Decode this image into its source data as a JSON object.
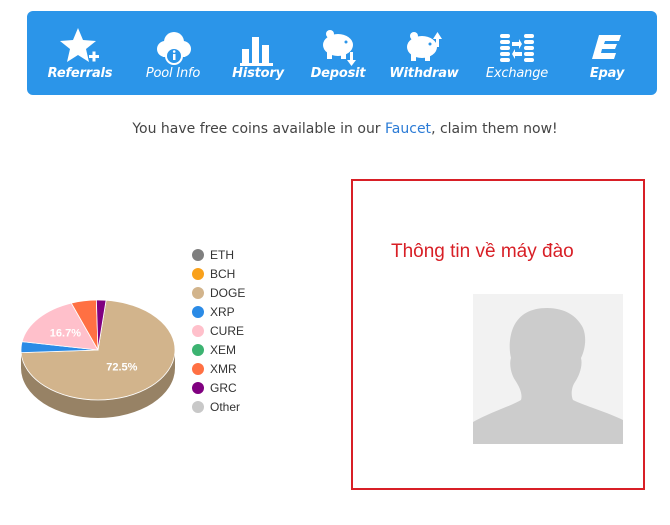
{
  "nav": {
    "items": [
      {
        "label": "Referrals",
        "icon": "star-plus-icon"
      },
      {
        "label": "Pool Info",
        "icon": "cloud-info-icon"
      },
      {
        "label": "History",
        "icon": "bar-chart-icon"
      },
      {
        "label": "Deposit",
        "icon": "piggy-bank-down-icon"
      },
      {
        "label": "Withdraw",
        "icon": "piggy-bank-up-icon"
      },
      {
        "label": "Exchange",
        "icon": "coins-exchange-icon"
      },
      {
        "label": "Epay",
        "icon": "epay-logo-icon"
      }
    ]
  },
  "faucet": {
    "prefix": "You have free coins available in our ",
    "link": "Faucet",
    "suffix": ", claim them now!"
  },
  "chart_data": {
    "type": "pie",
    "slices": [
      {
        "name": "ETH",
        "value": 0,
        "color": "#7f7f7f"
      },
      {
        "name": "BCH",
        "value": 0,
        "color": "#f9a11b"
      },
      {
        "name": "DOGE",
        "value": 72.5,
        "color": "#d2b48c"
      },
      {
        "name": "XRP",
        "value": 3.5,
        "color": "#2b8be6"
      },
      {
        "name": "CURE",
        "value": 16.7,
        "color": "#ffc0cb"
      },
      {
        "name": "XEM",
        "value": 0,
        "color": "#3cb371"
      },
      {
        "name": "XMR",
        "value": 5.3,
        "color": "#ff7043"
      },
      {
        "name": "GRC",
        "value": 2.0,
        "color": "#800080"
      },
      {
        "name": "Other",
        "value": 0,
        "color": "#c8c8c8"
      }
    ],
    "data_labels": [
      "72.5%",
      "16.7%"
    ]
  },
  "miner": {
    "title": "Thông tin về máy đào"
  },
  "colors": {
    "navbar": "#2b95e9",
    "accent_red": "#d81f26"
  }
}
